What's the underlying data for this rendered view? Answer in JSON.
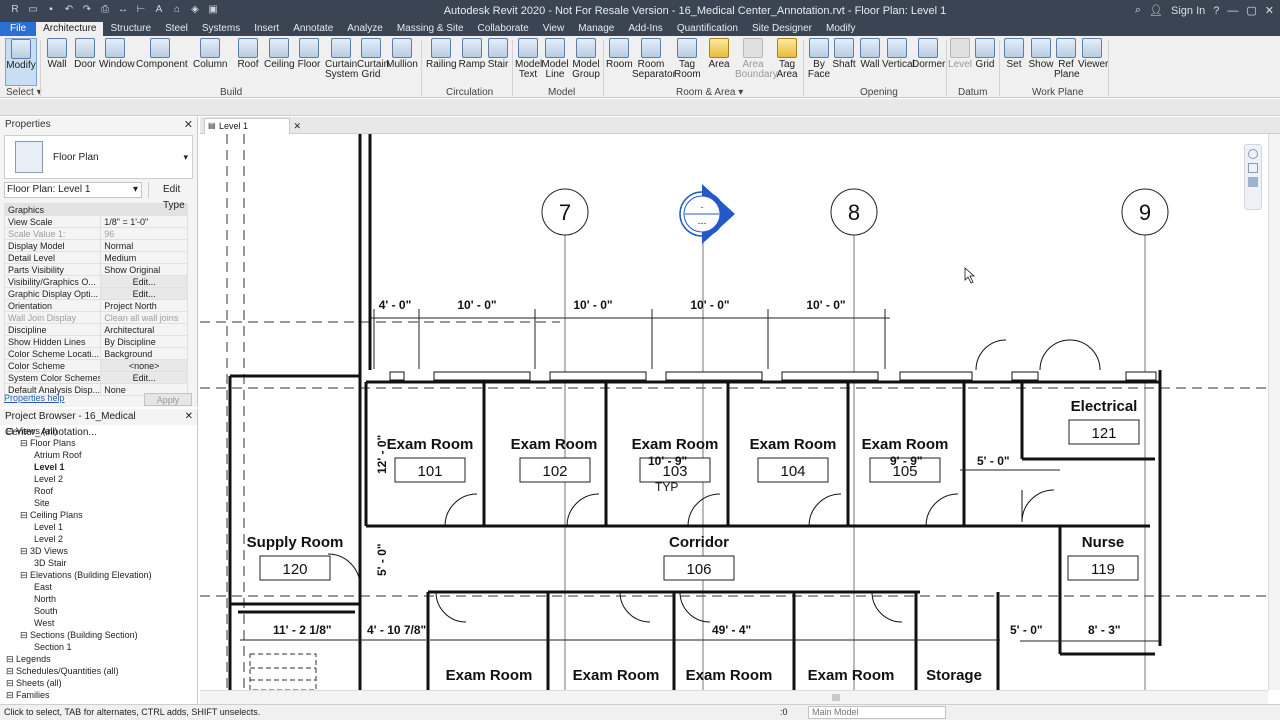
{
  "titlebar": {
    "title": "Autodesk Revit 2020 - Not For Resale Version - 16_Medical Center_Annotation.rvt - Floor Plan: Level 1",
    "sign_in": "Sign In"
  },
  "tabs": [
    "File",
    "Architecture",
    "Structure",
    "Steel",
    "Systems",
    "Insert",
    "Annotate",
    "Analyze",
    "Massing & Site",
    "Collaborate",
    "View",
    "Manage",
    "Add-Ins",
    "Quantification",
    "Site Designer",
    "Modify"
  ],
  "active_tab": "Architecture",
  "ribbon": {
    "select_label": "Select",
    "groups": [
      "Build",
      "Circulation",
      "Model",
      "Room & Area",
      "Opening",
      "Datum",
      "Work Plane"
    ],
    "buttons": {
      "modify": "Modify",
      "wall": "Wall",
      "door": "Door",
      "window": "Window",
      "component": "Component",
      "column": "Column",
      "roof": "Roof",
      "ceiling": "Ceiling",
      "floor": "Floor",
      "curtain_system": "Curtain System",
      "curtain_grid": "Curtain Grid",
      "mullion": "Mullion",
      "railing": "Railing",
      "ramp": "Ramp",
      "stair": "Stair",
      "model_text": "Model Text",
      "model_line": "Model Line",
      "model_group": "Model Group",
      "room": "Room",
      "room_separator": "Room Separator",
      "tag_room": "Tag Room",
      "area": "Area",
      "area_boundary": "Area Boundary",
      "tag_area": "Tag Area",
      "by_face": "By Face",
      "shaft": "Shaft",
      "wall_opening": "Wall",
      "vertical": "Vertical",
      "dormer": "Dormer",
      "level": "Level",
      "grid": "Grid",
      "set": "Set",
      "show": "Show",
      "ref_plane": "Ref Plane",
      "viewer": "Viewer"
    }
  },
  "properties": {
    "header": "Properties",
    "type_name": "Floor Plan",
    "instance_selector": "Floor Plan: Level 1",
    "edit_type": "Edit Type",
    "group": "Graphics",
    "rows": [
      {
        "k": "View Scale",
        "v": "1/8\" = 1'-0\""
      },
      {
        "k": "Scale Value    1:",
        "v": "96"
      },
      {
        "k": "Display Model",
        "v": "Normal"
      },
      {
        "k": "Detail Level",
        "v": "Medium"
      },
      {
        "k": "Parts Visibility",
        "v": "Show Original"
      },
      {
        "k": "Visibility/Graphics O...",
        "v": "Edit..."
      },
      {
        "k": "Graphic Display Opti...",
        "v": "Edit..."
      },
      {
        "k": "Orientation",
        "v": "Project North"
      },
      {
        "k": "Wall Join Display",
        "v": "Clean all wall joins"
      },
      {
        "k": "Discipline",
        "v": "Architectural"
      },
      {
        "k": "Show Hidden Lines",
        "v": "By Discipline"
      },
      {
        "k": "Color Scheme Locati...",
        "v": "Background"
      },
      {
        "k": "Color Scheme",
        "v": "<none>"
      },
      {
        "k": "System Color Schemes",
        "v": "Edit..."
      },
      {
        "k": "Default Analysis Disp...",
        "v": "None"
      }
    ],
    "help": "Properties help",
    "apply": "Apply"
  },
  "browser": {
    "header": "Project Browser - 16_Medical Center_Annotation...",
    "items": [
      {
        "t": "Views (all)",
        "lvl": 0
      },
      {
        "t": "Floor Plans",
        "lvl": 1
      },
      {
        "t": "Atrium Roof",
        "lvl": 2
      },
      {
        "t": "Level 1",
        "lvl": 2,
        "bold": true
      },
      {
        "t": "Level 2",
        "lvl": 2
      },
      {
        "t": "Roof",
        "lvl": 2
      },
      {
        "t": "Site",
        "lvl": 2
      },
      {
        "t": "Ceiling Plans",
        "lvl": 1
      },
      {
        "t": "Level 1",
        "lvl": 2
      },
      {
        "t": "Level 2",
        "lvl": 2
      },
      {
        "t": "3D Views",
        "lvl": 1
      },
      {
        "t": "3D Stair",
        "lvl": 2
      },
      {
        "t": "Elevations (Building Elevation)",
        "lvl": 1
      },
      {
        "t": "East",
        "lvl": 2
      },
      {
        "t": "North",
        "lvl": 2
      },
      {
        "t": "South",
        "lvl": 2
      },
      {
        "t": "West",
        "lvl": 2
      },
      {
        "t": "Sections (Building Section)",
        "lvl": 1
      },
      {
        "t": "Section 1",
        "lvl": 2
      },
      {
        "t": "Legends",
        "lvl": 0
      },
      {
        "t": "Schedules/Quantities (all)",
        "lvl": 0
      },
      {
        "t": "Sheets (all)",
        "lvl": 0
      },
      {
        "t": "Families",
        "lvl": 0
      }
    ]
  },
  "view_tab": "Level 1",
  "plan": {
    "grids": [
      "7",
      "8",
      "9"
    ],
    "top_dims": [
      "4' - 0\"",
      "10' - 0\"",
      "10' - 0\"",
      "10' - 0\"",
      "10' - 0\""
    ],
    "rooms_top": [
      {
        "name": "Exam Room",
        "num": "101"
      },
      {
        "name": "Exam Room",
        "num": "102"
      },
      {
        "name": "Exam Room",
        "num": "103"
      },
      {
        "name": "Exam Room",
        "num": "104"
      },
      {
        "name": "Exam Room",
        "num": "105"
      }
    ],
    "electrical": {
      "name": "Electrical",
      "num": "121"
    },
    "supply": {
      "name": "Supply Room",
      "num": "120"
    },
    "corridor": {
      "name": "Corridor",
      "num": "106"
    },
    "nurse": {
      "name": "Nurse",
      "num": "119"
    },
    "rooms_bottom": [
      "Exam Room",
      "Exam Room",
      "Exam Room",
      "Exam Room",
      "Storage"
    ],
    "dims": {
      "d12": "12' - 0\"",
      "d5v": "5' - 0\"",
      "d10_9": "10' - 9\"",
      "d9_9": "9' - 9\"",
      "d5h": "5' - 0\"",
      "typ": "TYP",
      "d11": "11' - 2 1/8\"",
      "d4_10": "4' - 10 7/8\"",
      "d49": "49' - 4\"",
      "d5b": "5' - 0\"",
      "d8_3": "8' - 3\""
    }
  },
  "status": {
    "message": "Click to select, TAB for alternates, CTRL adds, SHIFT unselects.",
    "zero": ":0",
    "model": "Main Model"
  }
}
